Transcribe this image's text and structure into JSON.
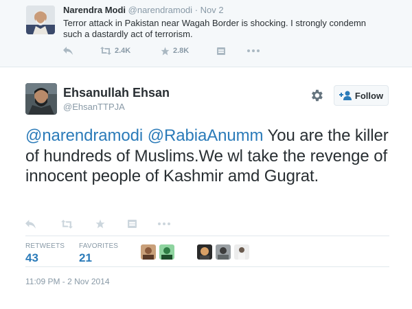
{
  "parent_tweet": {
    "name": "Narendra Modi",
    "handle": "@narendramodi",
    "date": "· Nov 2",
    "text": "Terror attack in Pakistan near Wagah Border is shocking. I strongly condemn such a dastardly act of terrorism.",
    "actions": {
      "reply_icon": "reply-icon",
      "retweet_icon": "retweet-icon",
      "retweet_count": "2.4K",
      "favorite_icon": "star-icon",
      "favorite_count": "2.8K",
      "bookmark_icon": "bookmark-icon",
      "more_icon": "more-icon"
    }
  },
  "main_tweet": {
    "name": "Ehsanullah Ehsan",
    "handle": "@EhsanTTPJA",
    "follow_label": "Follow",
    "text_mention_1": "@narendramodi",
    "text_mention_2": "@RabiaAnumm",
    "text_body": " You are the killer of hundreds of Muslims.We wl take the revenge of innocent people of Kashmir amd Gugrat.",
    "stats": {
      "retweets_label": "RETWEETS",
      "retweets_value": "43",
      "favorites_label": "FAVORITES",
      "favorites_value": "21"
    },
    "timestamp": "11:09 PM - 2 Nov 2014"
  },
  "colors": {
    "link_blue": "#2b7bb9",
    "muted_gray": "#8899a6",
    "icon_gray": "#ccd6dd",
    "parent_bg": "#f5f8fa"
  }
}
